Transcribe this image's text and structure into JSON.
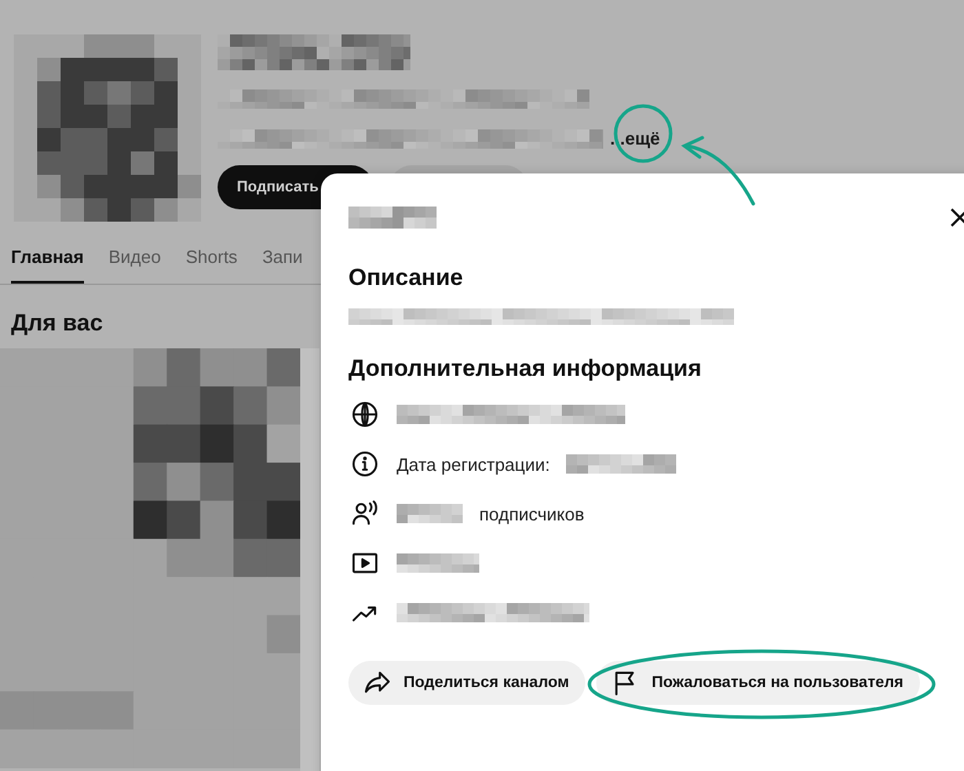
{
  "channel": {
    "more_link": "...ещё",
    "subscribe_button": "Подписать"
  },
  "tabs": [
    {
      "label": "Главная",
      "selected": true
    },
    {
      "label": "Видео",
      "selected": false
    },
    {
      "label": "Shorts",
      "selected": false
    },
    {
      "label": "Запи",
      "selected": false
    }
  ],
  "section_title": "Для вас",
  "dialog": {
    "description_heading": "Описание",
    "details_heading": "Дополнительная информация",
    "details": [
      {
        "kind": "website"
      },
      {
        "kind": "joined",
        "label": "Дата регистрации:"
      },
      {
        "kind": "subscribers",
        "suffix": "подписчиков"
      },
      {
        "kind": "videos"
      },
      {
        "kind": "views"
      }
    ],
    "buttons": [
      {
        "kind": "share",
        "label": "Поделиться каналом",
        "highlighted": false
      },
      {
        "kind": "report",
        "label": "Пожаловаться на пользователя",
        "highlighted": true
      }
    ]
  }
}
